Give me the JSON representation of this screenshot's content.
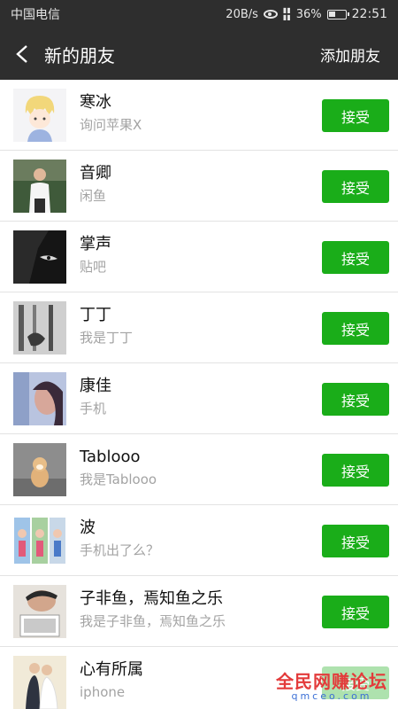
{
  "status_bar": {
    "carrier": "中国电信",
    "speed": "20B/s",
    "battery_percent": "36%",
    "time": "22:51"
  },
  "nav": {
    "title": "新的朋友",
    "action": "添加朋友"
  },
  "requests": [
    {
      "name": "寒冰",
      "note": "询问苹果X",
      "button": "接受"
    },
    {
      "name": "音卿",
      "note": "闲鱼",
      "button": "接受"
    },
    {
      "name": "掌声",
      "note": "贴吧",
      "button": "接受"
    },
    {
      "name": "丁丁",
      "note": "我是丁丁",
      "button": "接受"
    },
    {
      "name": "康佳",
      "note": "手机",
      "button": "接受"
    },
    {
      "name": "Tablooo",
      "note": "我是Tablooo",
      "button": "接受"
    },
    {
      "name": "波",
      "note": "手机出了么？",
      "button": "接受"
    },
    {
      "name": "子非鱼，焉知鱼之乐",
      "note": "我是子非鱼，焉知鱼之乐",
      "button": "接受"
    },
    {
      "name": "心有所属",
      "note": "iphone",
      "button": "接受"
    }
  ],
  "watermark": {
    "main": "全民网赚论坛",
    "url": "qmceo.com"
  },
  "colors": {
    "header_bg": "#2e2e2e",
    "accept_green": "#1aad19",
    "note_gray": "#a3a3a3"
  }
}
